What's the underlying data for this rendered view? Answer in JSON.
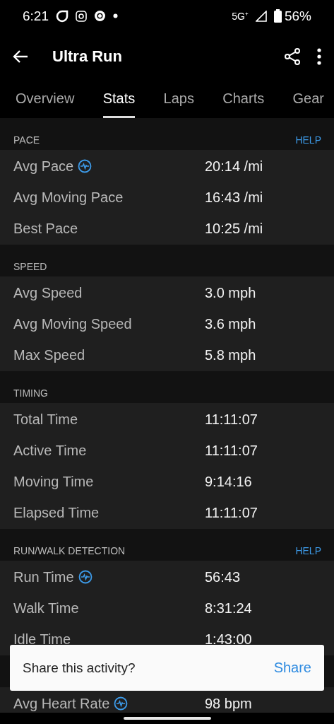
{
  "status_bar": {
    "time": "6:21",
    "network": "5G⁺",
    "battery": "56%"
  },
  "app_bar": {
    "title": "Ultra Run"
  },
  "tabs": [
    {
      "label": "Overview",
      "selected": false
    },
    {
      "label": "Stats",
      "selected": true
    },
    {
      "label": "Laps",
      "selected": false
    },
    {
      "label": "Charts",
      "selected": false
    },
    {
      "label": "Gear",
      "selected": false
    }
  ],
  "sections": [
    {
      "title": "PACE",
      "help": "HELP",
      "rows": [
        {
          "label": "Avg Pace",
          "value": "20:14 /mi",
          "chart_icon": true
        },
        {
          "label": "Avg Moving Pace",
          "value": "16:43 /mi",
          "chart_icon": false
        },
        {
          "label": "Best Pace",
          "value": "10:25 /mi",
          "chart_icon": false
        }
      ]
    },
    {
      "title": "SPEED",
      "rows": [
        {
          "label": "Avg Speed",
          "value": "3.0 mph",
          "chart_icon": false
        },
        {
          "label": "Avg Moving Speed",
          "value": "3.6 mph",
          "chart_icon": false
        },
        {
          "label": "Max Speed",
          "value": "5.8 mph",
          "chart_icon": false
        }
      ]
    },
    {
      "title": "TIMING",
      "rows": [
        {
          "label": "Total Time",
          "value": "11:11:07",
          "chart_icon": false
        },
        {
          "label": "Active Time",
          "value": "11:11:07",
          "chart_icon": false
        },
        {
          "label": "Moving Time",
          "value": "9:14:16",
          "chart_icon": false
        },
        {
          "label": "Elapsed Time",
          "value": "11:11:07",
          "chart_icon": false
        }
      ]
    },
    {
      "title": "RUN/WALK DETECTION",
      "help": "HELP",
      "rows": [
        {
          "label": "Run Time",
          "value": "56:43",
          "chart_icon": true
        },
        {
          "label": "Walk Time",
          "value": "8:31:24",
          "chart_icon": false
        },
        {
          "label": "Idle Time",
          "value": "1:43:00",
          "chart_icon": false
        }
      ]
    },
    {
      "rows": [
        {
          "label": "Avg Heart Rate",
          "value": "98 bpm",
          "chart_icon": true
        }
      ]
    }
  ],
  "snackbar": {
    "message": "Share this activity?",
    "action": "Share"
  }
}
